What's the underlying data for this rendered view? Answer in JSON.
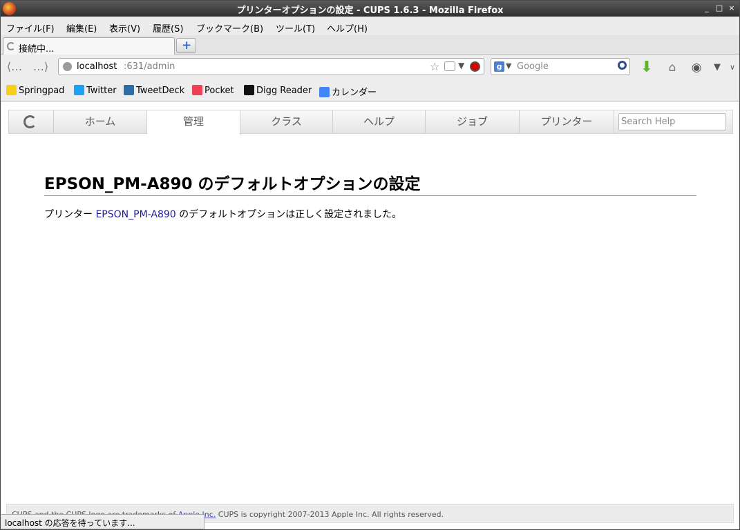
{
  "window": {
    "title": "プリンターオプションの設定 - CUPS 1.6.3 - Mozilla Firefox",
    "minimize": "_",
    "maximize": "□",
    "close": "×"
  },
  "menu": [
    "ファイル(F)",
    "編集(E)",
    "表示(V)",
    "履歴(S)",
    "ブックマーク(B)",
    "ツール(T)",
    "ヘルプ(H)"
  ],
  "tab": {
    "label": "接続中..."
  },
  "url": {
    "host": "localhost",
    "rest": ":631/admin"
  },
  "search": {
    "placeholder": "Google",
    "engine_icon": "g-icon"
  },
  "bookmarks": [
    "Springpad",
    "Twitter",
    "TweetDeck",
    "Pocket",
    "Digg Reader",
    "カレンダー"
  ],
  "cups_nav": {
    "items": [
      "ホーム",
      "管理",
      "クラス",
      "ヘルプ",
      "ジョブ",
      "プリンター"
    ],
    "active": "管理",
    "search_placeholder": "Search Help"
  },
  "page": {
    "heading": "EPSON_PM-A890 のデフォルトオプションの設定",
    "msg_prefix": "プリンター ",
    "msg_link": "EPSON_PM-A890",
    "msg_suffix": " のデフォルトオプションは正しく設定されました。"
  },
  "footer": {
    "prefix": "CUPS and the CUPS logo are trademarks of ",
    "link": "Apple Inc.",
    "suffix": " CUPS is copyright 2007-2013 Apple Inc. All rights reserved."
  },
  "status": "localhost の応答を待っています..."
}
